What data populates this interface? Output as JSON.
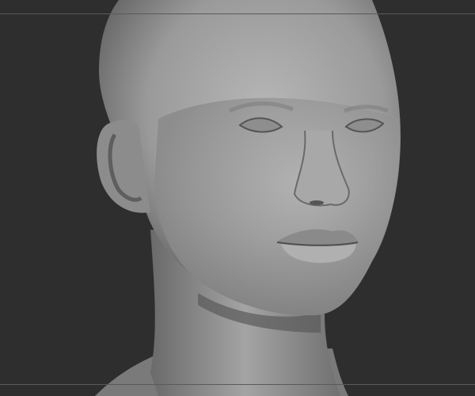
{
  "colors": {
    "background": "#2e2e2e",
    "guide_line": "#5a5a5a",
    "sculpt_light": "#b8b8b8",
    "sculpt_mid": "#8a8a8a",
    "sculpt_dark": "#4a4a4a"
  }
}
